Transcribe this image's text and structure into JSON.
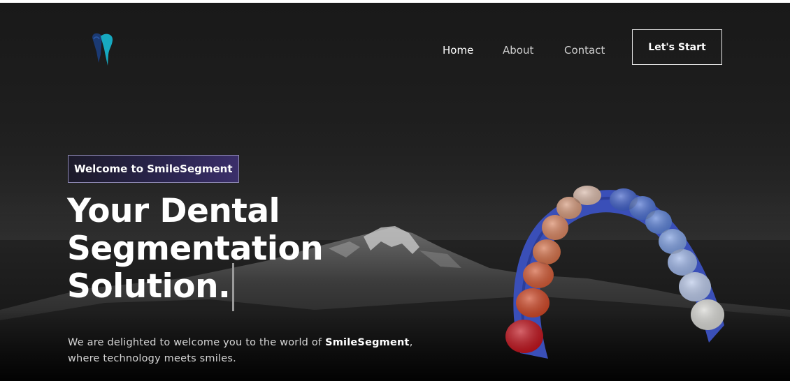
{
  "header": {
    "logo_icon": "tooth-icon",
    "nav": [
      {
        "label": "Home",
        "active": true
      },
      {
        "label": "About",
        "active": false
      },
      {
        "label": "Contact",
        "active": false
      }
    ],
    "cta_label": "Let's Start"
  },
  "hero": {
    "badge": "Welcome to SmileSegment",
    "headline": [
      "Your Dental",
      "Segmentation",
      "Solution."
    ],
    "subtext_intro": "We are delighted to welcome you to the world of ",
    "subtext_brand": "SmileSegment",
    "subtext_line2_lead": ",",
    "subtext_line2": "where technology meets smiles.",
    "image": "dental-arch-3d-model"
  },
  "colors": {
    "background": "#1e1e1e",
    "badge_gradient_end": "#3b2f6a",
    "logo_teal": "#17a9c0",
    "logo_navy": "#1b3a73",
    "arch_blue": "#3a4fb8",
    "tooth_red": "#c0121c"
  }
}
